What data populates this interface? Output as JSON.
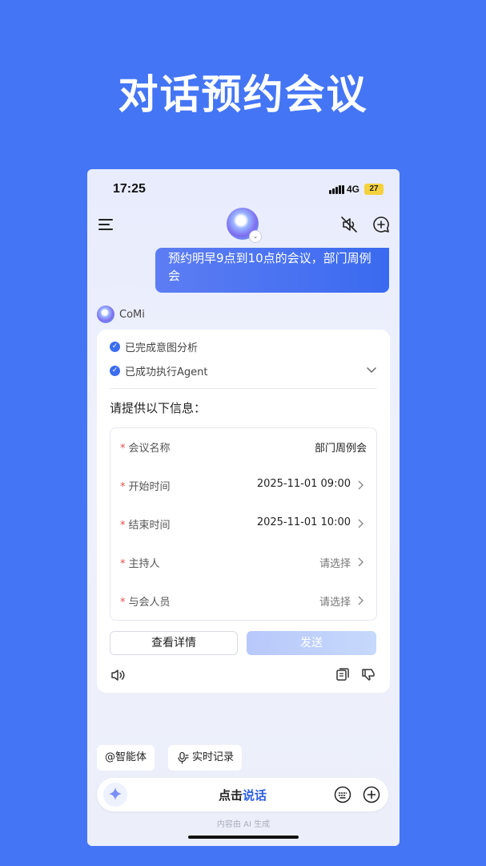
{
  "headline": "对话预约会议",
  "status": {
    "time": "17:25",
    "network": "4G",
    "battery": "27"
  },
  "header": {
    "menu_icon": "menu-icon",
    "avatar_icon": "assistant-avatar",
    "mute_icon": "mute-icon",
    "new_chat_icon": "new-chat-icon"
  },
  "user_message": "预约明早9点到10点的会议，部门周例会",
  "assistant": {
    "name": "CoMi",
    "steps": [
      "已完成意图分析",
      "已成功执行Agent"
    ],
    "prompt": "请提供以下信息：",
    "fields": [
      {
        "label": "会议名称",
        "value": "部门周例会",
        "placeholder": false,
        "chevron": false
      },
      {
        "label": "开始时间",
        "value": "2025-11-01 09:00",
        "placeholder": false,
        "chevron": true
      },
      {
        "label": "结束时间",
        "value": "2025-11-01 10:00",
        "placeholder": false,
        "chevron": true
      },
      {
        "label": "主持人",
        "value": "请选择",
        "placeholder": true,
        "chevron": true
      },
      {
        "label": "与会人员",
        "value": "请选择",
        "placeholder": true,
        "chevron": true
      }
    ],
    "required_mark": "*",
    "detail_button": "查看详情",
    "send_button": "发送"
  },
  "chips": {
    "agent": "@智能体",
    "record": "实时记录"
  },
  "input": {
    "talk_prefix": "点击",
    "talk_highlight": "说话"
  },
  "ai_note": "内容由 AI 生成",
  "colors": {
    "background": "#4475f5",
    "accent": "#3b6df0",
    "required": "#e34b4b"
  }
}
